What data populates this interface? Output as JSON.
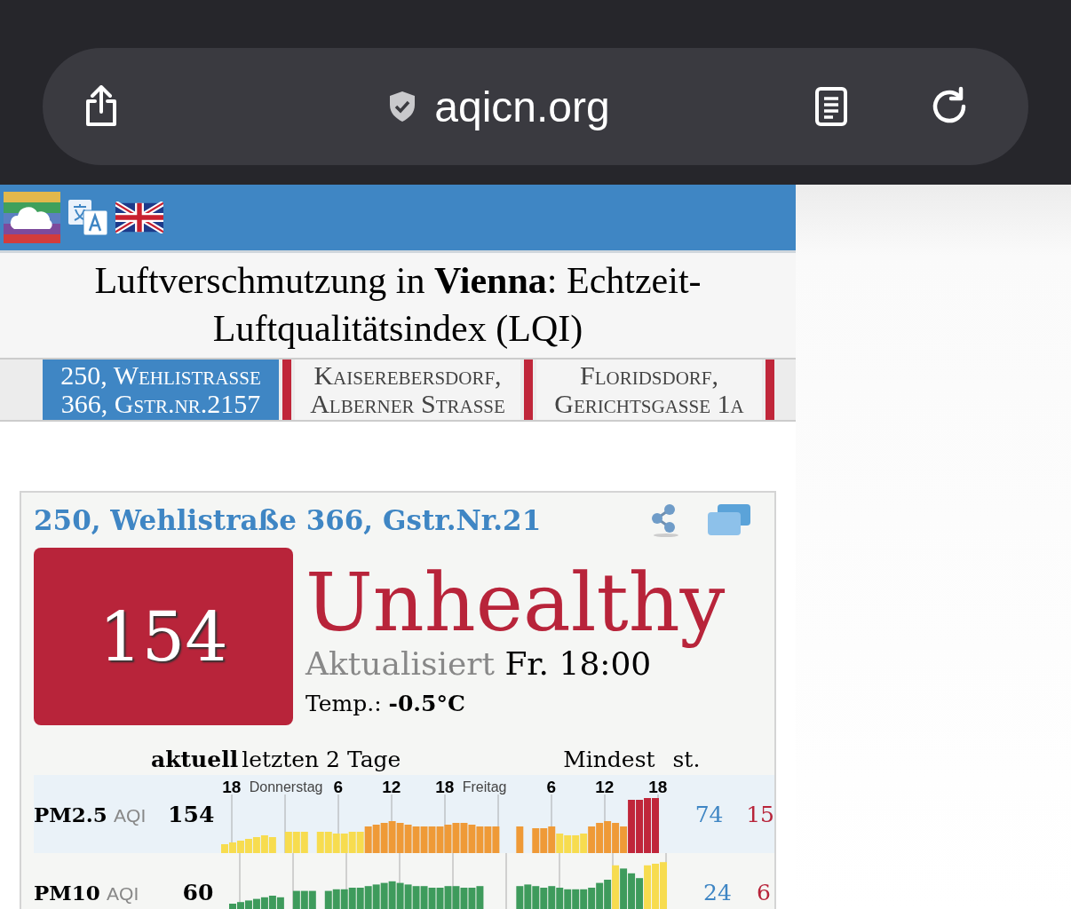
{
  "browser": {
    "url": "aqicn.org"
  },
  "page_title": "Luftverschmutzung in **Vienna**: Echtzeit-Luftqualitätsindex (LQI)",
  "station_tabs": [
    {
      "label": "250, Wehlistrasse 366, Gstr.nr.2157",
      "selected": true
    },
    {
      "label": "Kaiserebersdorf, Alberner Strasse",
      "selected": false
    },
    {
      "label": "Floridsdorf, Gerichtsgasse 1a",
      "selected": false
    }
  ],
  "station": {
    "name": "250, Wehlistraße 366, Gstr.Nr.21",
    "aqi": "154",
    "color": "#b8243a",
    "status": "Unhealthy",
    "updated_label": "Aktualisiert",
    "updated_time": "Fr. 18:00",
    "temp_label": "Temp.:",
    "temp_value": "-0.5°C"
  },
  "table": {
    "header_current": "aktuell",
    "header_history": "letzten 2 Tage",
    "header_min": "Mindest",
    "header_max": "st.",
    "time_labels": [
      "18",
      "Donnerstag",
      "6",
      "12",
      "18",
      "Freitag",
      "6",
      "12",
      "18"
    ],
    "rows": [
      {
        "name": "PM2.5",
        "unit": "AQI",
        "current": "154",
        "min": "74",
        "max": "15"
      },
      {
        "name": "PM10",
        "unit": "AQI",
        "current": "60",
        "min": "24",
        "max": "6"
      }
    ]
  }
}
